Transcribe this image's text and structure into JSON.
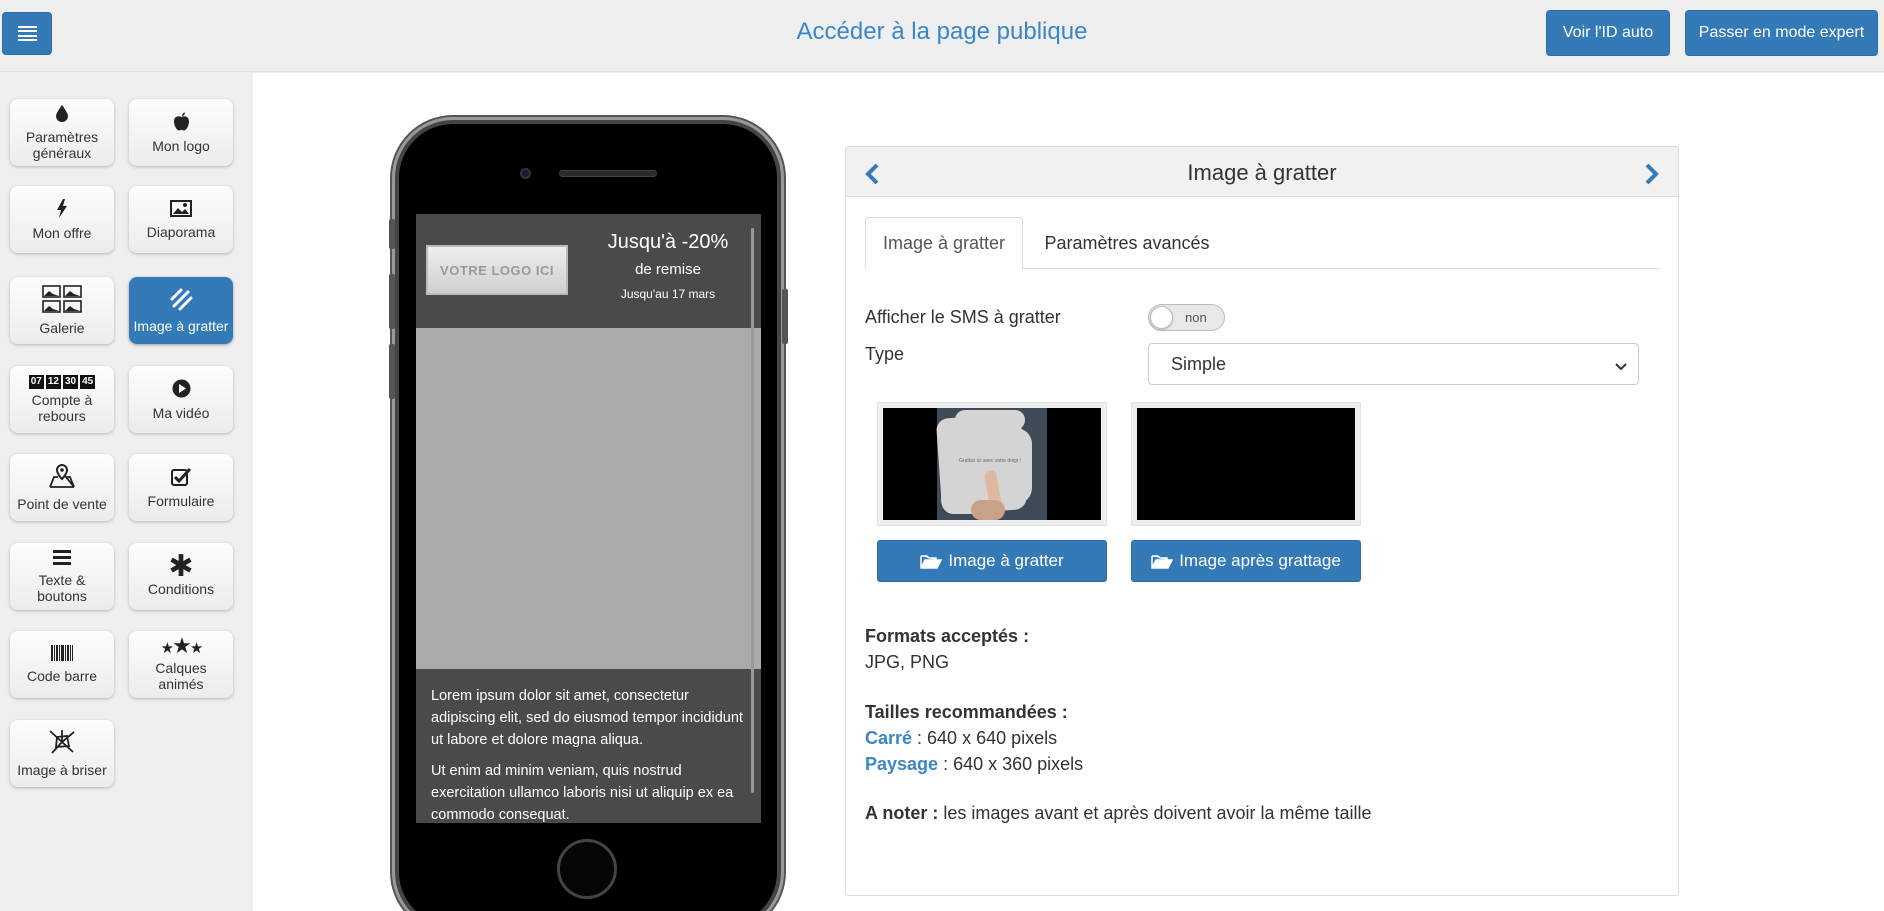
{
  "header": {
    "page_link": "Accéder à la page publique",
    "id_button": "Voir l'ID auto",
    "expert_button": "Passer en mode expert"
  },
  "sidebar": {
    "items": [
      {
        "label": "Paramètres généraux",
        "icon": "drop-icon"
      },
      {
        "label": "Mon logo",
        "icon": "apple-icon"
      },
      {
        "label": "Mon offre",
        "icon": "bolt-icon"
      },
      {
        "label": "Diaporama",
        "icon": "image-icon"
      },
      {
        "label": "Galerie",
        "icon": "gallery-icon"
      },
      {
        "label": "Image à gratter",
        "icon": "scratch-icon",
        "active": true
      },
      {
        "label": "Compte à rebours",
        "icon": "countdown-icon",
        "digits": [
          "07",
          "12",
          "30",
          "45"
        ]
      },
      {
        "label": "Ma vidéo",
        "icon": "play-icon"
      },
      {
        "label": "Point de vente",
        "icon": "map-pin-icon"
      },
      {
        "label": "Formulaire",
        "icon": "checkbox-icon"
      },
      {
        "label": "Texte & boutons",
        "icon": "list-icon"
      },
      {
        "label": "Conditions",
        "icon": "asterisk-icon"
      },
      {
        "label": "Code barre",
        "icon": "barcode-icon"
      },
      {
        "label": "Calques animés",
        "icon": "stars-icon"
      },
      {
        "label": "Image à briser",
        "icon": "broken-glass-icon"
      }
    ]
  },
  "phone": {
    "logo_placeholder": "VOTRE LOGO ICI",
    "promo_big": "Jusqu'à -20%",
    "promo_mid": "de remise",
    "promo_small": "Jusqu'au 17 mars",
    "para1": "Lorem ipsum dolor sit amet, consectetur adipiscing elit, sed do eiusmod tempor incididunt ut labore et dolore magna aliqua.",
    "para2": "Ut enim ad minim veniam, quis nostrud exercitation ullamco laboris nisi ut aliquip ex ea commodo consequat."
  },
  "panel": {
    "title": "Image à gratter",
    "tabs": [
      "Image à gratter",
      "Paramètres avancés"
    ],
    "sms_label": "Afficher le SMS à gratter",
    "sms_toggle": "non",
    "type_label": "Type",
    "type_value": "Simple",
    "thumb_caption": "Grattez ici avec votre doigt !",
    "upload_before": "Image à gratter",
    "upload_after": "Image après grattage",
    "formats_title": "Formats acceptés :",
    "formats_value": "JPG, PNG",
    "sizes_title": "Tailles recommandées :",
    "size_square_label": "Carré",
    "size_square_value": " : 640 x 640 pixels",
    "size_landscape_label": "Paysage",
    "size_landscape_value": " : 640 x 360 pixels",
    "note_title": "A noter :",
    "note_value": " les images avant et après doivent avoir la même taille"
  },
  "colors": {
    "accent": "#337ab7",
    "link": "#3a86c8",
    "phone_panel": "#4a4a4a",
    "scratch_area": "#aaaaaa"
  }
}
